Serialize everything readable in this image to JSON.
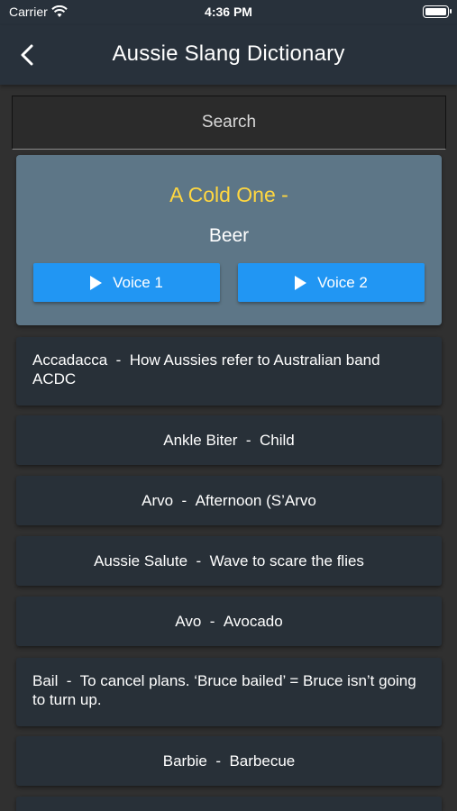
{
  "status_bar": {
    "carrier": "Carrier",
    "time": "4:36 PM"
  },
  "app_bar": {
    "title": "Aussie Slang Dictionary"
  },
  "search": {
    "placeholder": "Search"
  },
  "featured": {
    "term": "A Cold One",
    "separator": "  -",
    "meaning": "Beer",
    "voice1_label": "Voice 1",
    "voice2_label": "Voice 2"
  },
  "entries": [
    {
      "term": "Accadacca",
      "meaning": "How Aussies refer to Australian band ACDC"
    },
    {
      "term": "Ankle Biter",
      "meaning": "Child"
    },
    {
      "term": "Arvo",
      "meaning": "Afternoon (S’Arvo"
    },
    {
      "term": "Aussie Salute",
      "meaning": "Wave to scare the flies"
    },
    {
      "term": "Avo",
      "meaning": "Avocado"
    },
    {
      "term": "Bail",
      "meaning": "To cancel plans. ‘Bruce bailed’ = Bruce isn’t going to turn up."
    },
    {
      "term": "Barbie",
      "meaning": "Barbecue"
    }
  ],
  "separator": "  -  ",
  "colors": {
    "app_bar": "#28313b",
    "accent_yellow": "#ffd740",
    "button_blue": "#2196f3",
    "featured_bg": "#5d7687"
  }
}
